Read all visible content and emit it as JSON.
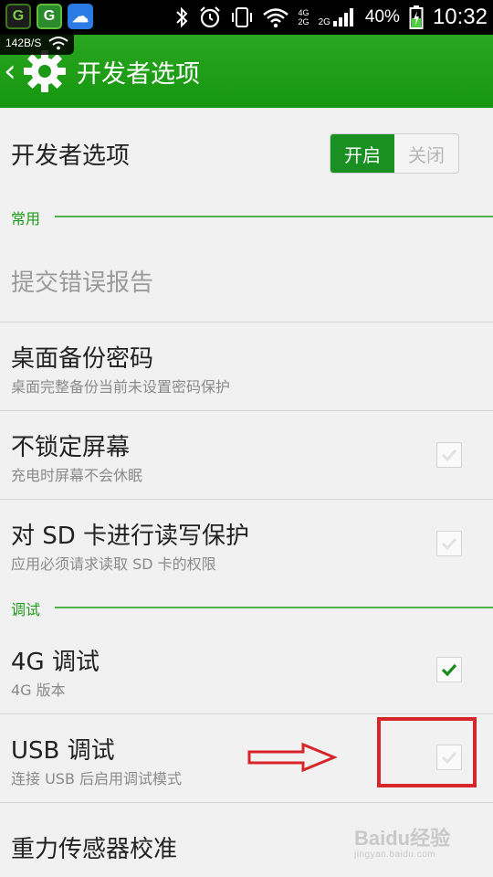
{
  "status_bar": {
    "app_icons": [
      "G",
      "G",
      "☁"
    ],
    "net_speed": "142B/S",
    "network": "4G",
    "network2": "2G",
    "network3": "2G",
    "battery_percent": "40%",
    "time": "10:32"
  },
  "header": {
    "title": "开发者选项"
  },
  "developer_toggle": {
    "title": "开发者选项",
    "on_label": "开启",
    "off_label": "关闭",
    "state": "on"
  },
  "sections": {
    "common": "常用",
    "debug": "调试"
  },
  "items": {
    "bug_report": {
      "title": "提交错误报告",
      "enabled": false
    },
    "backup_password": {
      "title": "桌面备份密码",
      "subtitle": "桌面完整备份当前未设置密码保护"
    },
    "stay_awake": {
      "title": "不锁定屏幕",
      "subtitle": "充电时屏幕不会休眠",
      "checked": false
    },
    "sd_protect": {
      "title": "对 SD 卡进行读写保护",
      "subtitle": "应用必须请求读取 SD 卡的权限",
      "checked": false
    },
    "debug_4g": {
      "title": "4G 调试",
      "subtitle": "4G 版本",
      "checked": true
    },
    "usb_debug": {
      "title": "USB 调试",
      "subtitle": "连接 USB 后启用调试模式",
      "checked": false
    },
    "gravity_calib": {
      "title": "重力传感器校准"
    }
  },
  "watermark": {
    "brand": "Baidu经验",
    "url": "jingyan.baidu.com"
  },
  "colors": {
    "header_green": "#1a9a14",
    "accent_green": "#1f9c1a",
    "highlight_red": "#d6262a"
  }
}
